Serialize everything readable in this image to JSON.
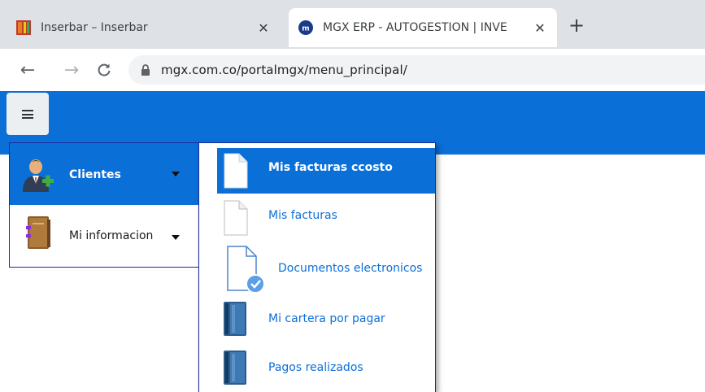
{
  "browser": {
    "tabs": [
      {
        "title": "Inserbar – Inserbar",
        "active": false
      },
      {
        "title": "MGX ERP - AUTOGESTION | INVE",
        "active": true
      }
    ],
    "url": "mgx.com.co/portalmgx/menu_principal/"
  },
  "theme": {
    "primary": "#0b6fd8",
    "border": "#1a2a9e"
  },
  "menu": {
    "items": [
      {
        "label": "Clientes",
        "icon": "user-add-icon",
        "active": true
      },
      {
        "label": "Mi informacion",
        "icon": "book-icon",
        "active": false
      }
    ]
  },
  "submenu": {
    "items": [
      {
        "label": "Mis facturas ccosto",
        "icon": "document-icon",
        "active": true
      },
      {
        "label": "Mis facturas",
        "icon": "document-icon",
        "active": false
      },
      {
        "label": "Documentos electronicos",
        "icon": "document-check-icon",
        "active": false
      },
      {
        "label": "Mi cartera por pagar",
        "icon": "ledger-icon",
        "active": false
      },
      {
        "label": "Pagos realizados",
        "icon": "ledger-icon",
        "active": false
      }
    ]
  }
}
